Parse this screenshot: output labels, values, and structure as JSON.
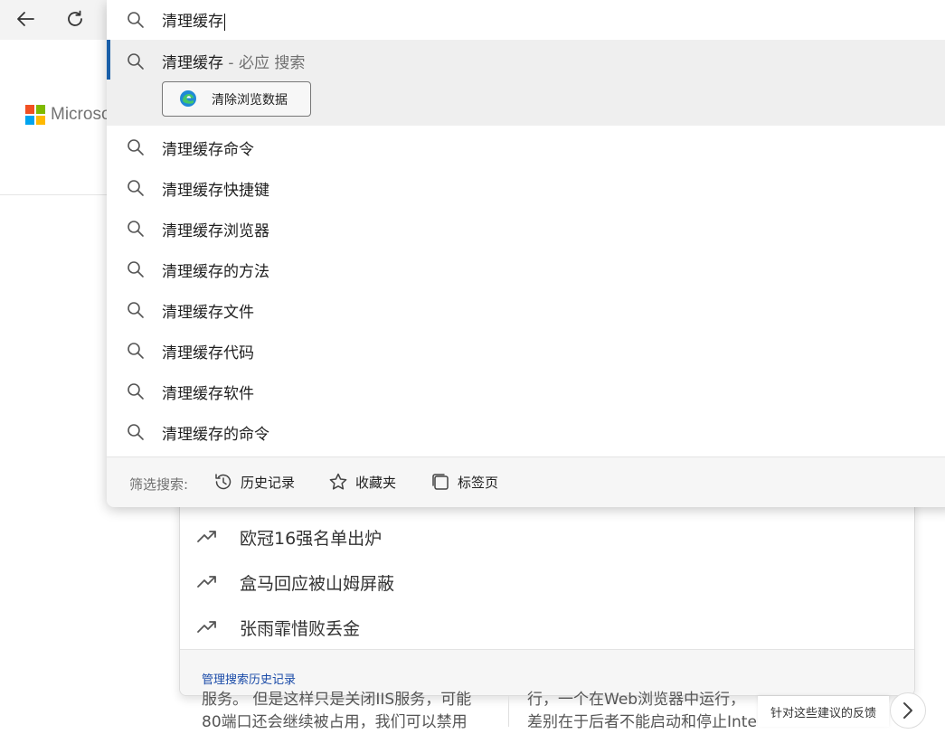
{
  "browser": {
    "address_text": "清理缓存"
  },
  "page": {
    "brand_text": "Microso"
  },
  "top_suggestion": {
    "query": "清理缓存",
    "engine_suffix": " - 必应 搜索",
    "action_label": "清除浏览数据"
  },
  "suggestions": [
    {
      "label": "清理缓存命令"
    },
    {
      "label": "清理缓存快捷键"
    },
    {
      "label": "清理缓存浏览器"
    },
    {
      "label": "清理缓存的方法"
    },
    {
      "label": "清理缓存文件"
    },
    {
      "label": "清理缓存代码"
    },
    {
      "label": "清理缓存软件"
    },
    {
      "label": "清理缓存的命令"
    }
  ],
  "filter": {
    "label": "筛选搜索:",
    "history": "历史记录",
    "favorites": "收藏夹",
    "tabs": "标签页"
  },
  "trending": {
    "items": [
      {
        "label": "欧冠16强名单出炉"
      },
      {
        "label": "盒马回应被山姆屏蔽"
      },
      {
        "label": "张雨霏惜败丢金"
      }
    ],
    "manage_link": "管理搜索历史记录"
  },
  "articles": {
    "left_line1": "服务。 但是这样只是关闭IIS服务，可能",
    "left_line2": "80端口还会继续被占用，我们可以禁用",
    "right_line1": "行，一个在Web浏览器中运行，",
    "right_line2": "差别在于后者不能启动和停止Inte"
  },
  "feedback_label": "针对这些建议的反馈",
  "colors": {
    "accent": "#1a5fa8",
    "link": "#1a4ba8"
  }
}
